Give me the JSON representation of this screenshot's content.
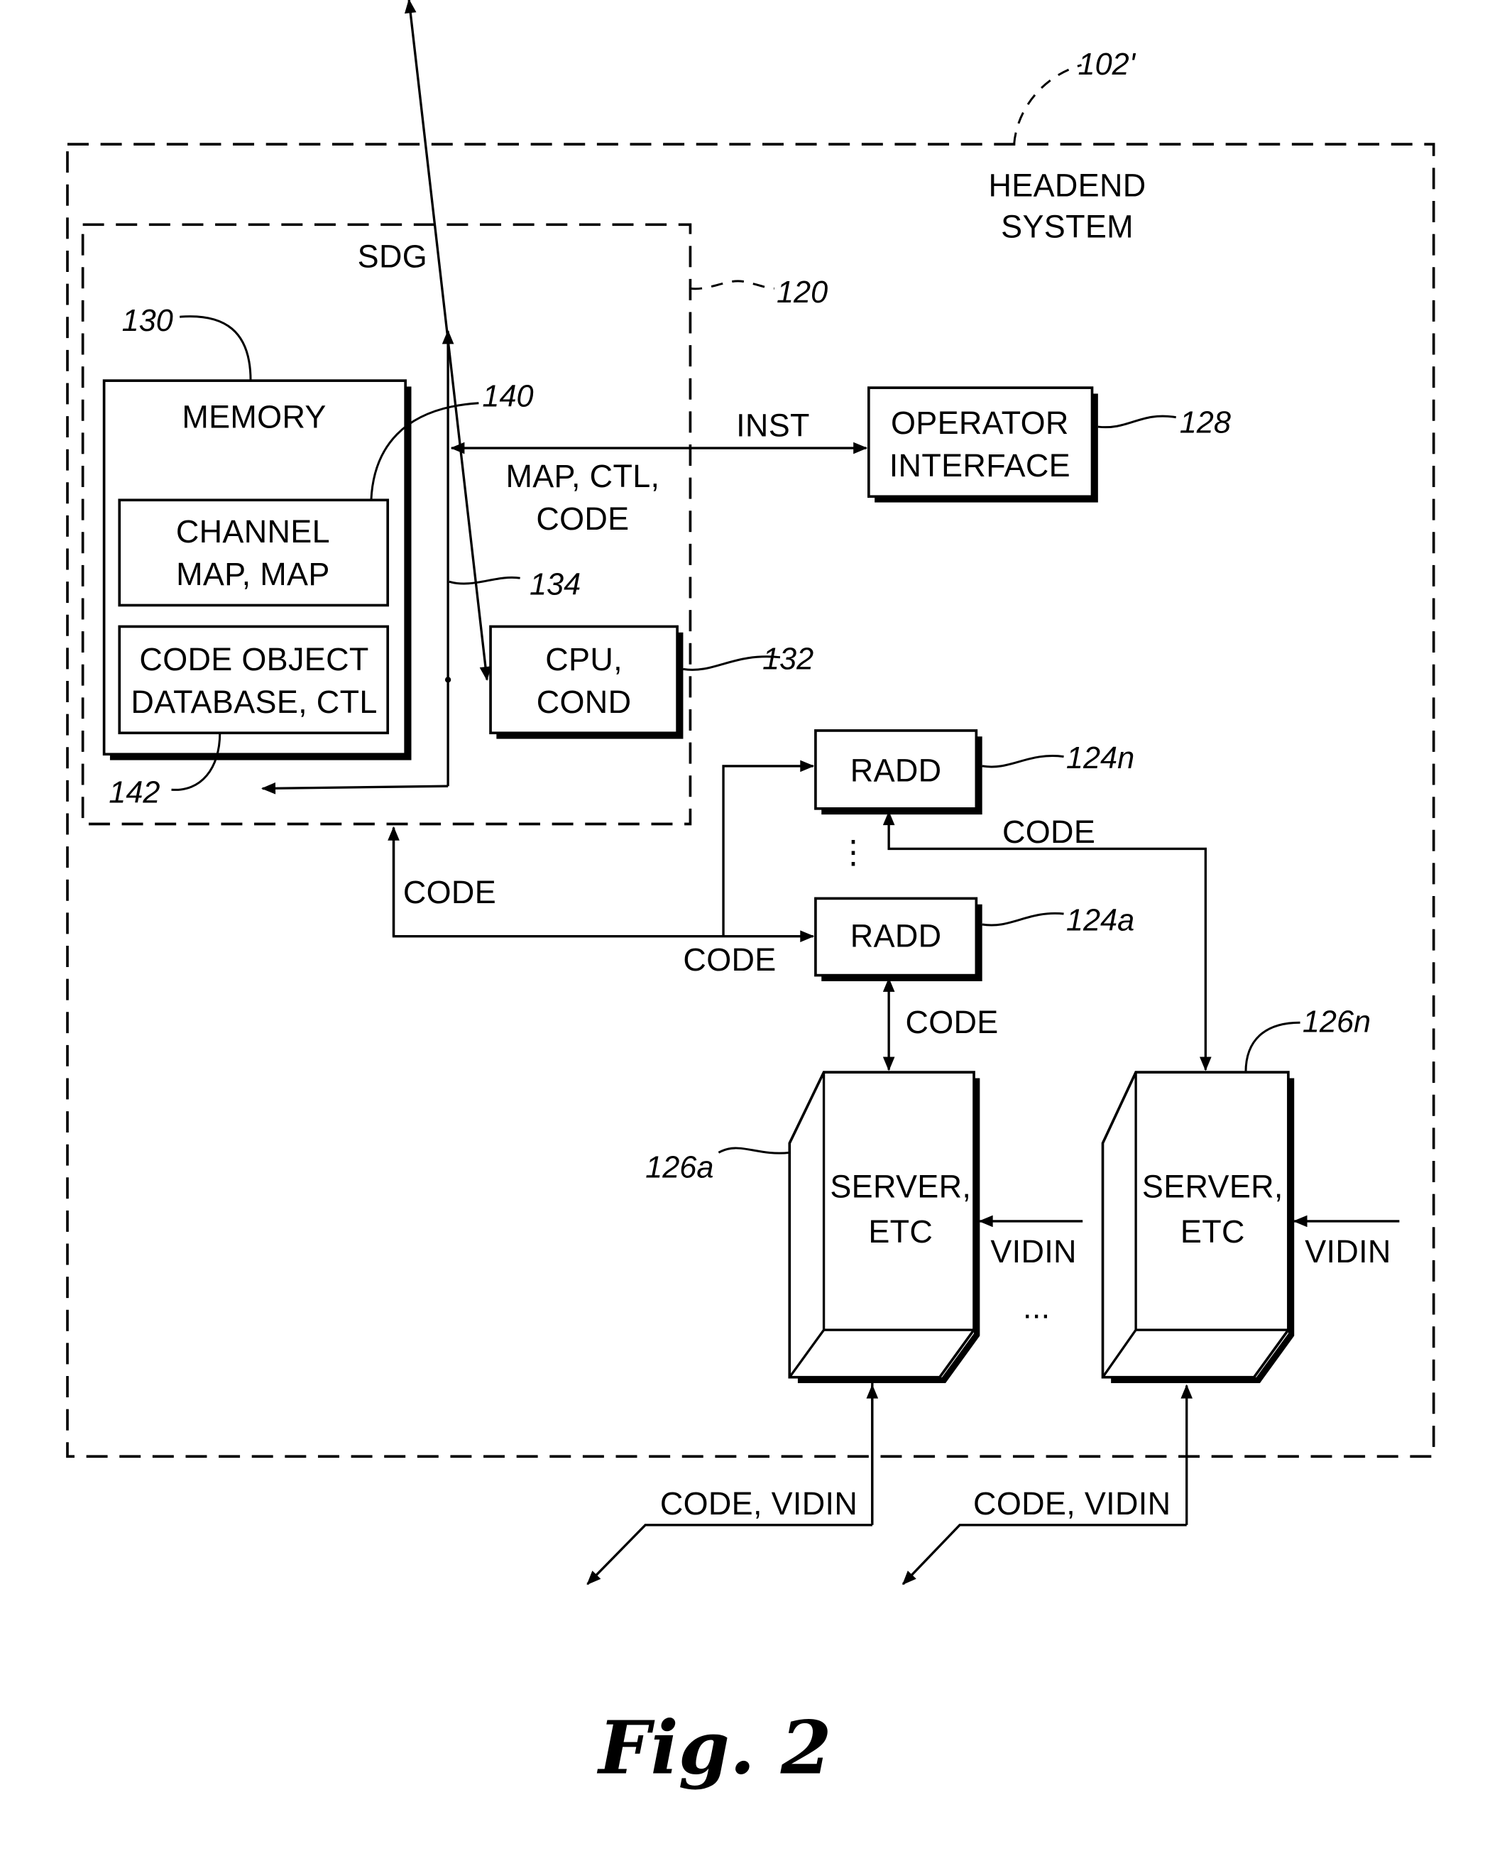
{
  "figure": {
    "caption": "Fig. 2"
  },
  "headend": {
    "ref": "102'",
    "title_line1": "HEADEND",
    "title_line2": "SYSTEM"
  },
  "sdg": {
    "ref": "120",
    "title": "SDG"
  },
  "memory": {
    "ref": "130",
    "title": "MEMORY",
    "channel_map": {
      "ref": "140",
      "line1": "CHANNEL",
      "line2": "MAP,  MAP"
    },
    "code_object_db": {
      "ref": "142",
      "line1": "CODE OBJECT",
      "line2": "DATABASE, CTL"
    }
  },
  "bus": {
    "ref": "134",
    "label_line1": "MAP, CTL,",
    "label_line2": "CODE"
  },
  "cpu": {
    "ref": "132",
    "line1": "CPU,",
    "line2": "COND"
  },
  "operator_interface": {
    "ref": "128",
    "line1": "OPERATOR",
    "line2": "INTERFACE",
    "link_label": "INST"
  },
  "radd_n": {
    "ref": "124n",
    "label": "RADD"
  },
  "radd_a": {
    "ref": "124a",
    "label": "RADD"
  },
  "links": {
    "sdg_code": "CODE",
    "radd_feed_code": "CODE",
    "radd_n_server_code": "CODE",
    "radd_a_server_code": "CODE",
    "ellipsis_vertical": "⋮",
    "ellipsis_horizontal": "..."
  },
  "server_a": {
    "ref": "126a",
    "line1": "SERVER,",
    "line2": "ETC",
    "input_label": "VIDIN",
    "output_label": "CODE, VIDIN"
  },
  "server_n": {
    "ref": "126n",
    "line1": "SERVER,",
    "line2": "ETC",
    "input_label": "VIDIN",
    "output_label": "CODE, VIDIN"
  }
}
